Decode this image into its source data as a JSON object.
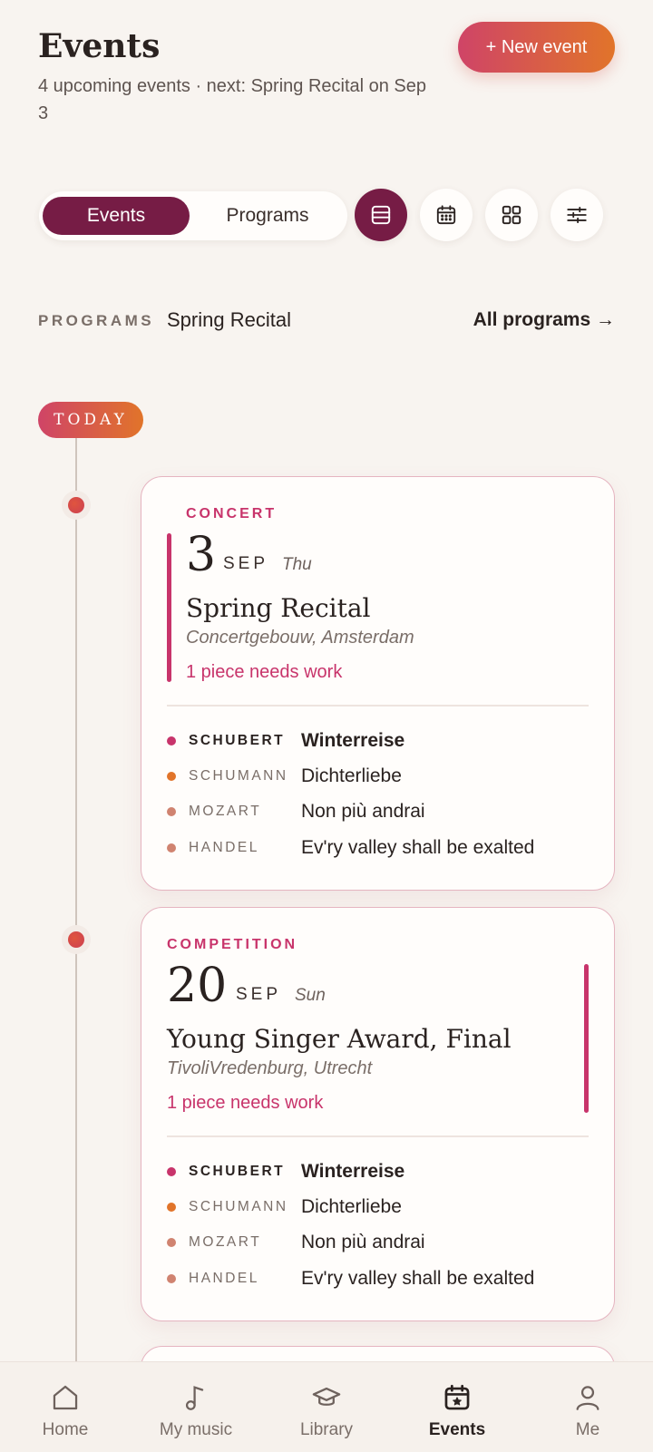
{
  "header": {
    "title": "Events",
    "subtitle": "4 upcoming events · next: Spring Recital on Sep 3",
    "new_event_label": "+ New event"
  },
  "segment": {
    "options": [
      "Events",
      "Programs"
    ],
    "selected": "Events"
  },
  "view_buttons": [
    {
      "icon": "list-view-icon",
      "active": true
    },
    {
      "icon": "calendar-icon",
      "active": false
    },
    {
      "icon": "grid-view-icon",
      "active": false
    },
    {
      "icon": "filter-sliders-icon",
      "active": false
    }
  ],
  "programs_bar": {
    "label": "PROGRAMS",
    "value": "Spring Recital",
    "link": "All programs →"
  },
  "timeline": {
    "today_label": "TODAY"
  },
  "events": [
    {
      "type": "CONCERT",
      "day": "3",
      "month": "SEP",
      "weekday": "Thu",
      "title": "Spring Recital",
      "venue": "Concertgebouw, Amsterdam",
      "status": "1 piece needs work",
      "pieces": [
        {
          "composer": "SCHUBERT",
          "work": "Winterreise",
          "dot_color": "#c8346b"
        },
        {
          "composer": "SCHUMANN",
          "work": "Dichterliebe",
          "dot_color": "#e1742a"
        },
        {
          "composer": "MOZART",
          "work": "Non più andrai",
          "dot_color": "#d08370"
        },
        {
          "composer": "HANDEL",
          "work": "Ev'ry valley shall be exalted",
          "dot_color": "#d08370"
        }
      ]
    },
    {
      "type": "COMPETITION",
      "day": "20",
      "month": "SEP",
      "weekday": "Sun",
      "title": "Young Singer Award, Final",
      "venue": "TivoliVredenburg, Utrecht",
      "status": "1 piece needs work",
      "pieces": [
        {
          "composer": "SCHUBERT",
          "work": "Winterreise",
          "dot_color": "#c8346b"
        },
        {
          "composer": "SCHUMANN",
          "work": "Dichterliebe",
          "dot_color": "#e1742a"
        },
        {
          "composer": "MOZART",
          "work": "Non più andrai",
          "dot_color": "#d08370"
        },
        {
          "composer": "HANDEL",
          "work": "Ev'ry valley shall be exalted",
          "dot_color": "#d08370"
        }
      ]
    }
  ],
  "bottom_nav": [
    {
      "label": "Home",
      "icon": "home-icon",
      "active": false
    },
    {
      "label": "My music",
      "icon": "music-note-icon",
      "active": false
    },
    {
      "label": "Library",
      "icon": "graduation-cap-icon",
      "active": false
    },
    {
      "label": "Events",
      "icon": "calendar-star-icon",
      "active": true
    },
    {
      "label": "Me",
      "icon": "person-icon",
      "active": false
    }
  ],
  "colors": {
    "accent_dark": "#761c45",
    "accent_pink": "#c8346b",
    "accent_orange": "#e1742a",
    "background": "#f8f4f0"
  }
}
